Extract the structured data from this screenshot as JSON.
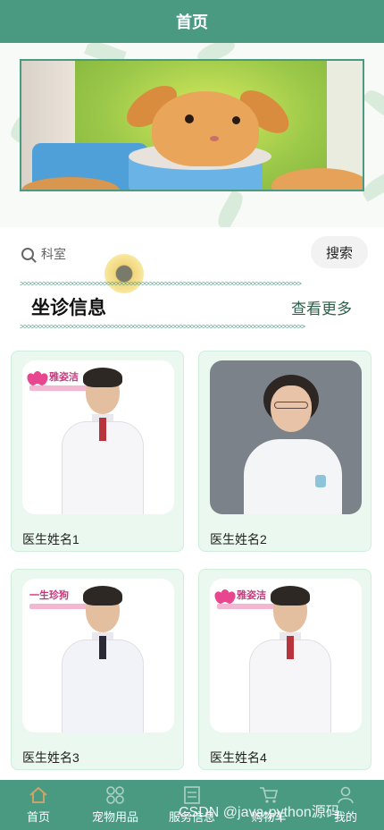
{
  "header": {
    "title": "首页"
  },
  "search": {
    "placeholder": "科室",
    "button_label": "搜索"
  },
  "section": {
    "title": "坐诊信息",
    "more_label": "查看更多"
  },
  "doctors": [
    {
      "name": "医生姓名1",
      "logo_text": "雅姿洁"
    },
    {
      "name": "医生姓名2"
    },
    {
      "name": "医生姓名3",
      "logo_text": "一生珍狗"
    },
    {
      "name": "医生姓名4",
      "logo_text": "雅姿洁"
    }
  ],
  "tabbar": {
    "items": [
      {
        "label": "首页",
        "icon": "home-icon",
        "active": true
      },
      {
        "label": "宠物用品",
        "icon": "grid-icon"
      },
      {
        "label": "服务信息",
        "icon": "document-icon"
      },
      {
        "label": "购物车",
        "icon": "cart-icon"
      },
      {
        "label": "我的",
        "icon": "user-icon"
      }
    ]
  },
  "watermark": "CSDN @java-python源码",
  "colors": {
    "primary": "#4a9a82",
    "card_bg": "#eaf8ef"
  }
}
